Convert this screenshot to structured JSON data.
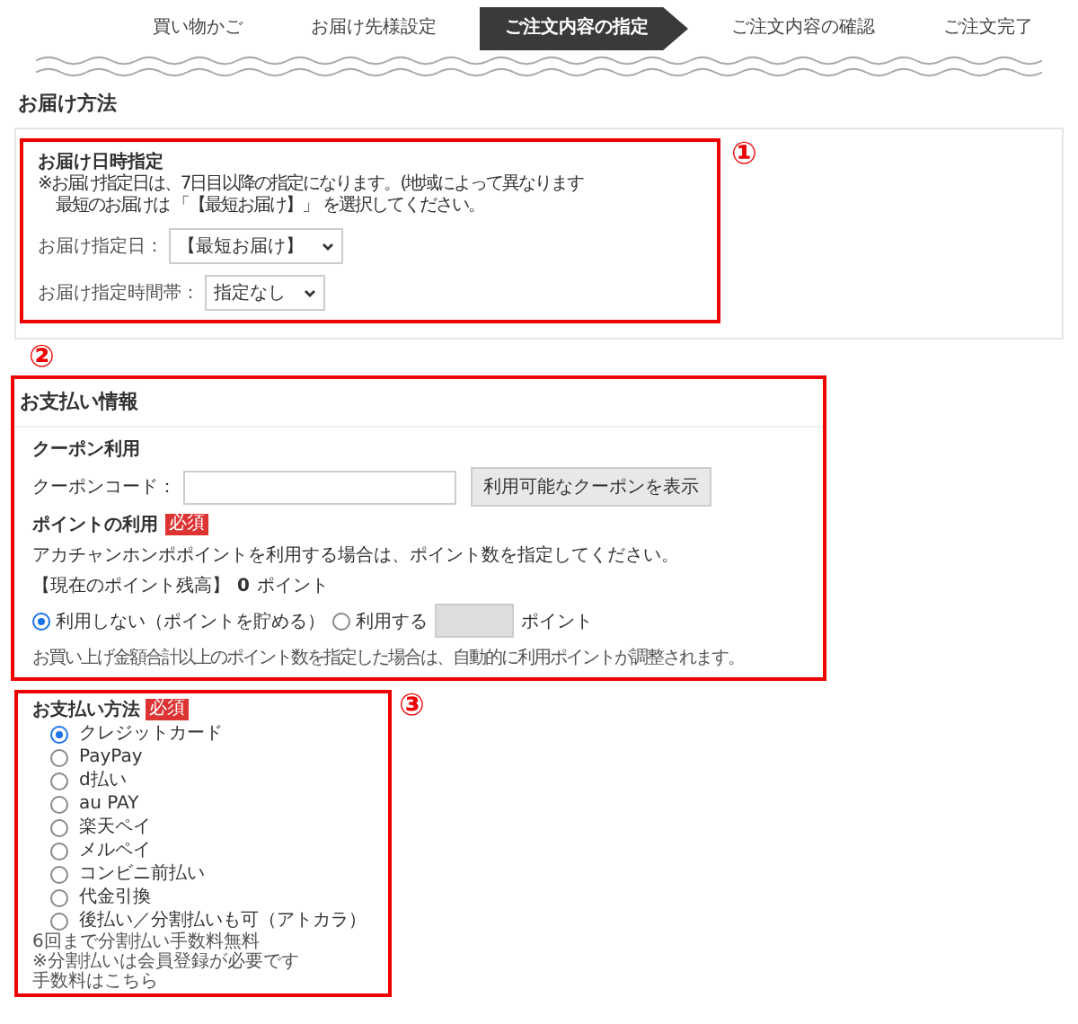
{
  "steps": [
    {
      "label": "買い物かご",
      "selected": false
    },
    {
      "label": "お届け先様設定",
      "selected": false
    },
    {
      "label": "ご注文内容の指定",
      "selected": true
    },
    {
      "label": "ご注文内容の確認",
      "selected": false
    },
    {
      "label": "ご注文完了",
      "selected": false
    }
  ],
  "delivery": {
    "heading": "お届け方法",
    "marker": "①",
    "title": "お届け日時指定",
    "notes": [
      "※お届け指定日は、7日目以降の指定になります。(地域によって異なります",
      "最短のお届けは 「【最短お届け】」 を選択してください。"
    ],
    "fields": [
      {
        "label": "お届け指定日：",
        "value": "【最短お届け】"
      },
      {
        "label": "お届け指定時間帯：",
        "value": "指定なし"
      }
    ]
  },
  "payment_info": {
    "marker": "②",
    "heading": "お支払い情報",
    "coupon_title": "クーポン利用",
    "coupon_label": "クーポンコード：",
    "coupon_button": "利用可能なクーポンを表示",
    "points_title": "ポイントの利用",
    "badge": "必須",
    "points_note": "アカチャンホンポポイントを利用する場合は、ポイント数を指定してください。",
    "balance": "【現在のポイント残高】**0**ポイント",
    "options": [
      {
        "label": "利用しない（ポイントを貯める）",
        "selected": true
      },
      {
        "label": "利用する",
        "selected": false
      }
    ],
    "unit": "ポイント",
    "footnote": "お買い上げ金額合計以上のポイント数を指定した場合は、自動的に利用ポイントが調整されます。"
  },
  "payment_method": {
    "marker": "③",
    "title": "お支払い方法",
    "badge": "必須",
    "options": [
      {
        "label": "クレジットカード",
        "selected": true
      },
      {
        "label": "PayPay",
        "selected": false
      },
      {
        "label": "d払い",
        "selected": false
      },
      {
        "label": "au PAY",
        "selected": false
      },
      {
        "label": "楽天ペイ",
        "selected": false
      },
      {
        "label": "メルペイ",
        "selected": false
      },
      {
        "label": "コンビニ前払い",
        "selected": false
      },
      {
        "label": "代金引換",
        "selected": false
      },
      {
        "label": "後払い／分割払いも可（アトカラ）",
        "selected": false
      }
    ],
    "notes": [
      "6回まで分割払い手数料無料",
      "※分割払いは会員登録が必要です",
      "手数料はこちら"
    ]
  }
}
